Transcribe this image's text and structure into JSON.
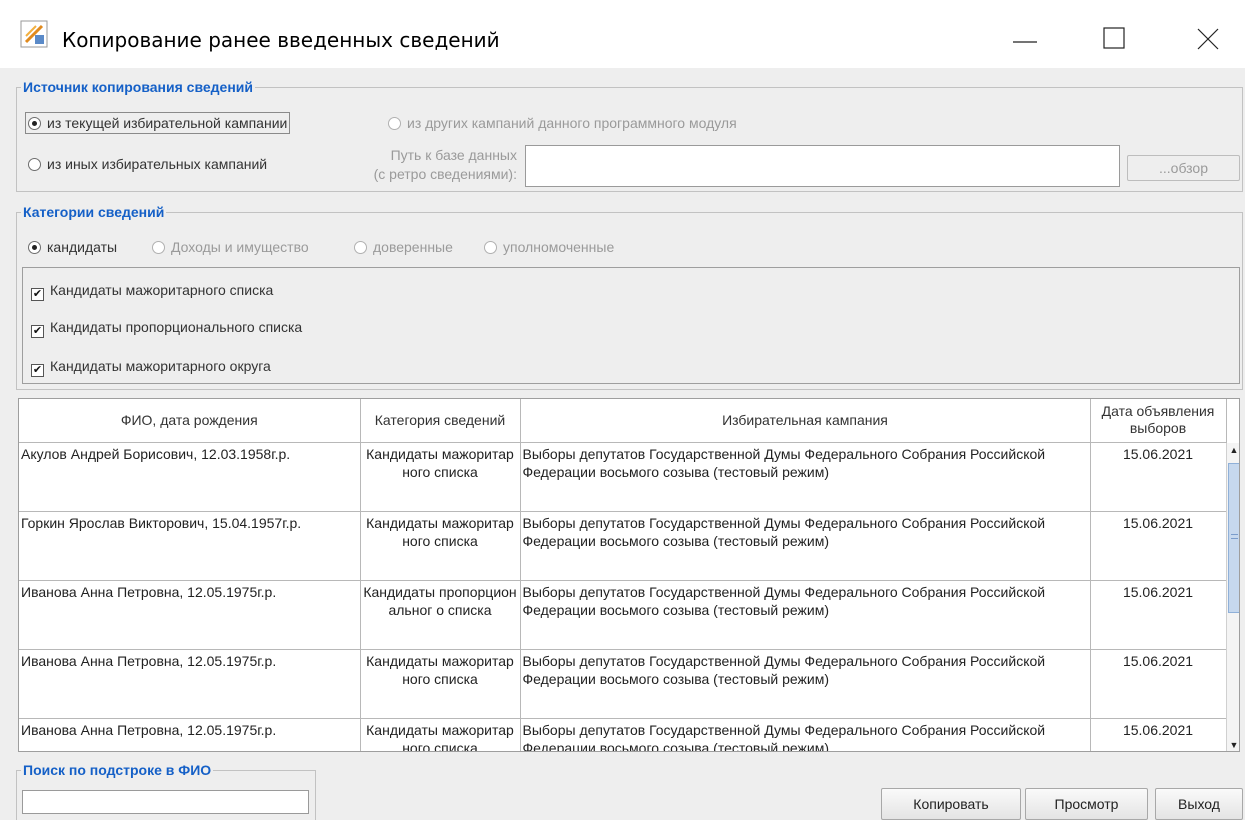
{
  "window": {
    "title": "Копирование ранее введенных сведений"
  },
  "source": {
    "legend": "Источник копирования сведений",
    "opt_current": "из текущей избирательной кампании",
    "opt_other_module": "из других кампаний данного программного модуля",
    "opt_other": "из иных избирательных кампаний",
    "db_path_label_1": "Путь к базе данных",
    "db_path_label_2": "(с ретро сведениями):",
    "db_path_value": "",
    "browse_label": "...обзор"
  },
  "categories": {
    "legend": "Категории сведений",
    "radios": [
      "кандидаты",
      "Доходы и имущество",
      "доверенные",
      "уполномоченные"
    ],
    "checkboxes": [
      "Кандидаты мажоритарного списка",
      "Кандидаты пропорционального списка",
      "Кандидаты мажоритарного округа"
    ]
  },
  "table": {
    "headers": [
      "ФИО, дата рождения",
      "Категория сведений",
      "Избирательная кампания",
      "Дата объявления выборов"
    ],
    "rows": [
      {
        "fio": "Акулов Андрей Борисович, 12.03.1958г.р.",
        "category": "Кандидаты мажоритарного списка",
        "campaign": "Выборы депутатов Государственной Думы Федерального Собрания Российской Федерации восьмого созыва (тестовый режим)",
        "date": "15.06.2021"
      },
      {
        "fio": "Горкин Ярослав Викторович, 15.04.1957г.р.",
        "category": "Кандидаты мажоритарного списка",
        "campaign": "Выборы депутатов Государственной Думы Федерального Собрания Российской Федерации восьмого созыва (тестовый режим)",
        "date": "15.06.2021"
      },
      {
        "fio": "Иванова Анна Петровна, 12.05.1975г.р.",
        "category": "Кандидаты пропорциональног о списка",
        "campaign": "Выборы депутатов Государственной Думы Федерального Собрания Российской Федерации восьмого созыва (тестовый режим)",
        "date": "15.06.2021"
      },
      {
        "fio": "Иванова Анна Петровна, 12.05.1975г.р.",
        "category": "Кандидаты мажоритарного списка",
        "campaign": "Выборы депутатов Государственной Думы Федерального Собрания Российской Федерации восьмого созыва (тестовый режим)",
        "date": "15.06.2021"
      },
      {
        "fio": "Иванова Анна Петровна, 12.05.1975г.р.",
        "category": "Кандидаты мажоритарного списка",
        "campaign": "Выборы депутатов Государственной Думы Федерального Собрания Российской Федерации восьмого созыва (тестовый режим)",
        "date": "15.06.2021"
      }
    ]
  },
  "search": {
    "legend": "Поиск по подстроке в ФИО",
    "value": ""
  },
  "buttons": {
    "copy": "Копировать",
    "preview": "Просмотр",
    "exit": "Выход"
  },
  "colors": {
    "legend": "#1560c7",
    "disabled_text": "#9a9a9a",
    "app_icon": "#f0a030"
  }
}
